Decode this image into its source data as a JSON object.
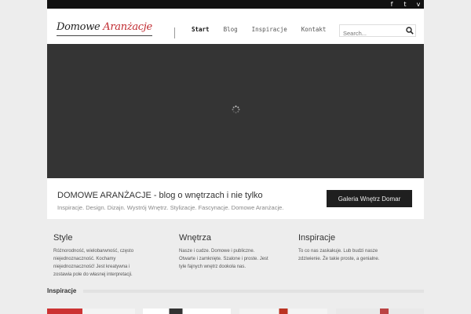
{
  "social": [
    {
      "name": "facebook-icon",
      "glyph": "f"
    },
    {
      "name": "twitter-icon",
      "glyph": "t"
    },
    {
      "name": "vimeo-icon",
      "glyph": "v"
    }
  ],
  "logo": {
    "part1": "Domowe ",
    "part2": "Aranżacje"
  },
  "nav": [
    {
      "label": "Start",
      "active": true
    },
    {
      "label": "Blog",
      "active": false
    },
    {
      "label": "Inspiracje",
      "active": false
    },
    {
      "label": "Kontakt",
      "active": false
    }
  ],
  "search": {
    "placeholder": "Search..."
  },
  "tagline": {
    "title": "DOMOWE ARANŻACJE - blog o wnętrzach i nie tylko",
    "subtitle": "Inspiracje. Design. Dizajn. Wystrój Wnętrz. Stylizacje. Fascynacje. Domowe Aranżacje.",
    "button": "Galeria Wnętrz Domar"
  },
  "columns": [
    {
      "title": "Style",
      "text": "Różnorodność, wielobarwność, często niejednoznaczność. Kochamy niejednoznaczność! Jest kreatywna i zostawia pole do własnej interpretacji."
    },
    {
      "title": "Wnętrza",
      "text": "Nasze i cudze. Domowe i publiczne. Otwarte i zamknięte. Szalone i proste. Jest tyle fajnych wnętrz dookoła nas."
    },
    {
      "title": "Inspiracje",
      "text": "To co nas zaskakuje. Lub budzi nasze zdziwienie. Że takie proste, a genialne."
    }
  ],
  "section": {
    "title": "Inspiracje"
  },
  "colors": {
    "accent": "#c0292f",
    "dark": "#343434"
  }
}
